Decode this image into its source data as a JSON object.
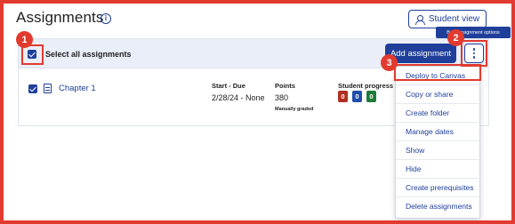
{
  "header": {
    "title": "Assignments",
    "info_icon": "info-icon",
    "student_view_label": "Student view",
    "student_view_icon": "person-icon"
  },
  "toolbar": {
    "select_all_label": "Select all assignments",
    "select_all_checked": true,
    "add_assignment_label": "Add assignment",
    "more_options_icon": "more-vertical-icon",
    "tooltip": "Bulk assignment options"
  },
  "assignments": [
    {
      "checked": true,
      "icon": "document-icon",
      "title": "Chapter 1",
      "start_due_header": "Start - Due",
      "start_due": "2/28/24 - None",
      "points_header": "Points",
      "points": "380",
      "grading": "Manually graded",
      "progress_header": "Student progress",
      "progress": [
        "0",
        "0",
        "0"
      ]
    }
  ],
  "menu": {
    "items": [
      "Deploy to Canvas",
      "Copy or share",
      "Create folder",
      "Manage dates",
      "Show",
      "Hide",
      "Create prerequisites",
      "Delete assignments"
    ]
  },
  "annotations": {
    "steps": [
      "1",
      "2",
      "3"
    ],
    "color": "#e23a2f"
  },
  "colors": {
    "accent": "#1f3f9a",
    "toolbar_bg": "#e9eef8",
    "badge_red": "#b22f22",
    "badge_blue": "#1f4fa8",
    "badge_green": "#1f7a3a"
  }
}
